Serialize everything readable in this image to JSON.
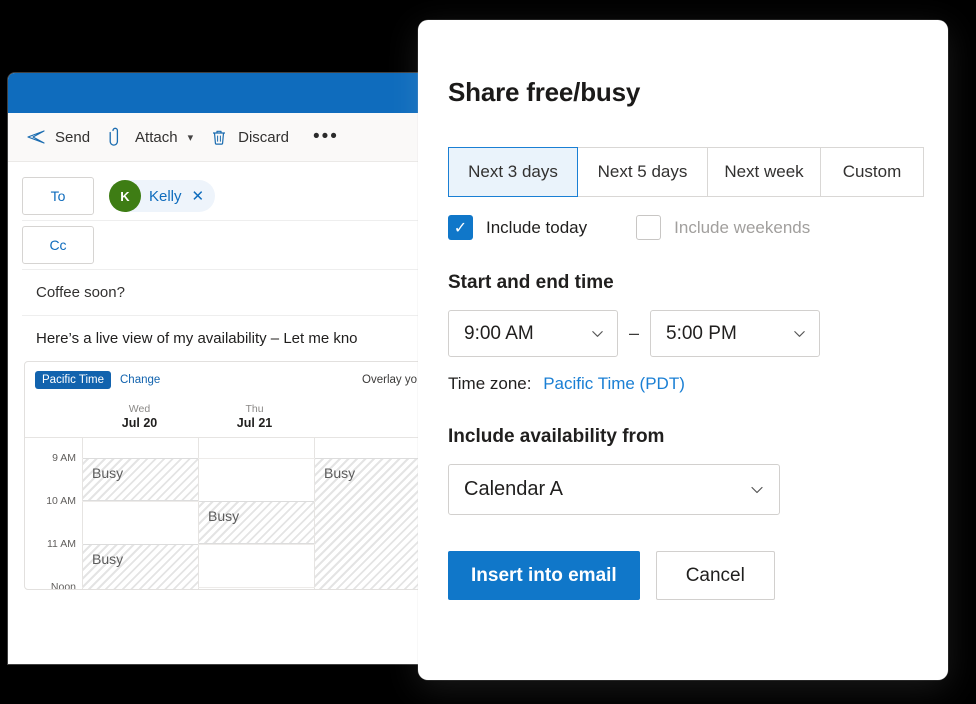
{
  "compose": {
    "toolbar": {
      "send_label": "Send",
      "attach_label": "Attach",
      "discard_label": "Discard",
      "more_label": "•••"
    },
    "to_field_label": "To",
    "cc_field_label": "Cc",
    "recipient": {
      "initial": "K",
      "name": "Kelly",
      "remove_label": "✕",
      "avatar_color": "#3e7d14"
    },
    "subject": "Coffee soon?",
    "body_text": "Here’s a live view of my availability – Let me kno",
    "availability_card": {
      "timezone_badge": "Pacific Time",
      "change_link": "Change",
      "overlay_text": "Overlay yo",
      "days": [
        {
          "dow": "Wed",
          "date": "Jul 20"
        },
        {
          "dow": "Thu",
          "date": "Jul 21"
        },
        {
          "dow": "",
          "date": ""
        }
      ],
      "hour_labels": [
        "9 AM",
        "10 AM",
        "11 AM",
        "Noon"
      ],
      "busy_label": "Busy",
      "busy_blocks": [
        {
          "day": 0,
          "start_hour": "9 AM",
          "end_hour": "10 AM",
          "label": "Busy"
        },
        {
          "day": 1,
          "start_hour": "10 AM",
          "end_hour": "11 AM",
          "label": "Busy"
        },
        {
          "day": 0,
          "start_hour": "11 AM",
          "end_hour": "Noon",
          "label": "Busy"
        },
        {
          "day": 2,
          "start_hour": "9 AM",
          "end_hour": "Noon",
          "label": "Busy"
        }
      ]
    }
  },
  "dialog": {
    "title": "Share free/busy",
    "range_options": [
      {
        "label": "Next 3 days",
        "selected": true
      },
      {
        "label": "Next 5 days",
        "selected": false
      },
      {
        "label": "Next week",
        "selected": false
      },
      {
        "label": "Custom",
        "selected": false
      }
    ],
    "include_today": {
      "label": "Include today",
      "checked": true,
      "check_glyph": "✓"
    },
    "include_weekends": {
      "label": "Include weekends",
      "checked": false
    },
    "time_section_heading": "Start and end time",
    "start_time": "9:00 AM",
    "end_time": "5:00 PM",
    "time_separator": "–",
    "timezone_label": "Time zone:",
    "timezone_value": "Pacific Time (PDT)",
    "calendar_section_heading": "Include availability from",
    "calendar_value": "Calendar A",
    "primary_button": "Insert into email",
    "secondary_button": "Cancel",
    "accent_color": "#1077c9",
    "link_color": "#1a7fd4",
    "selected_tab_bg": "#eaf3fb"
  }
}
